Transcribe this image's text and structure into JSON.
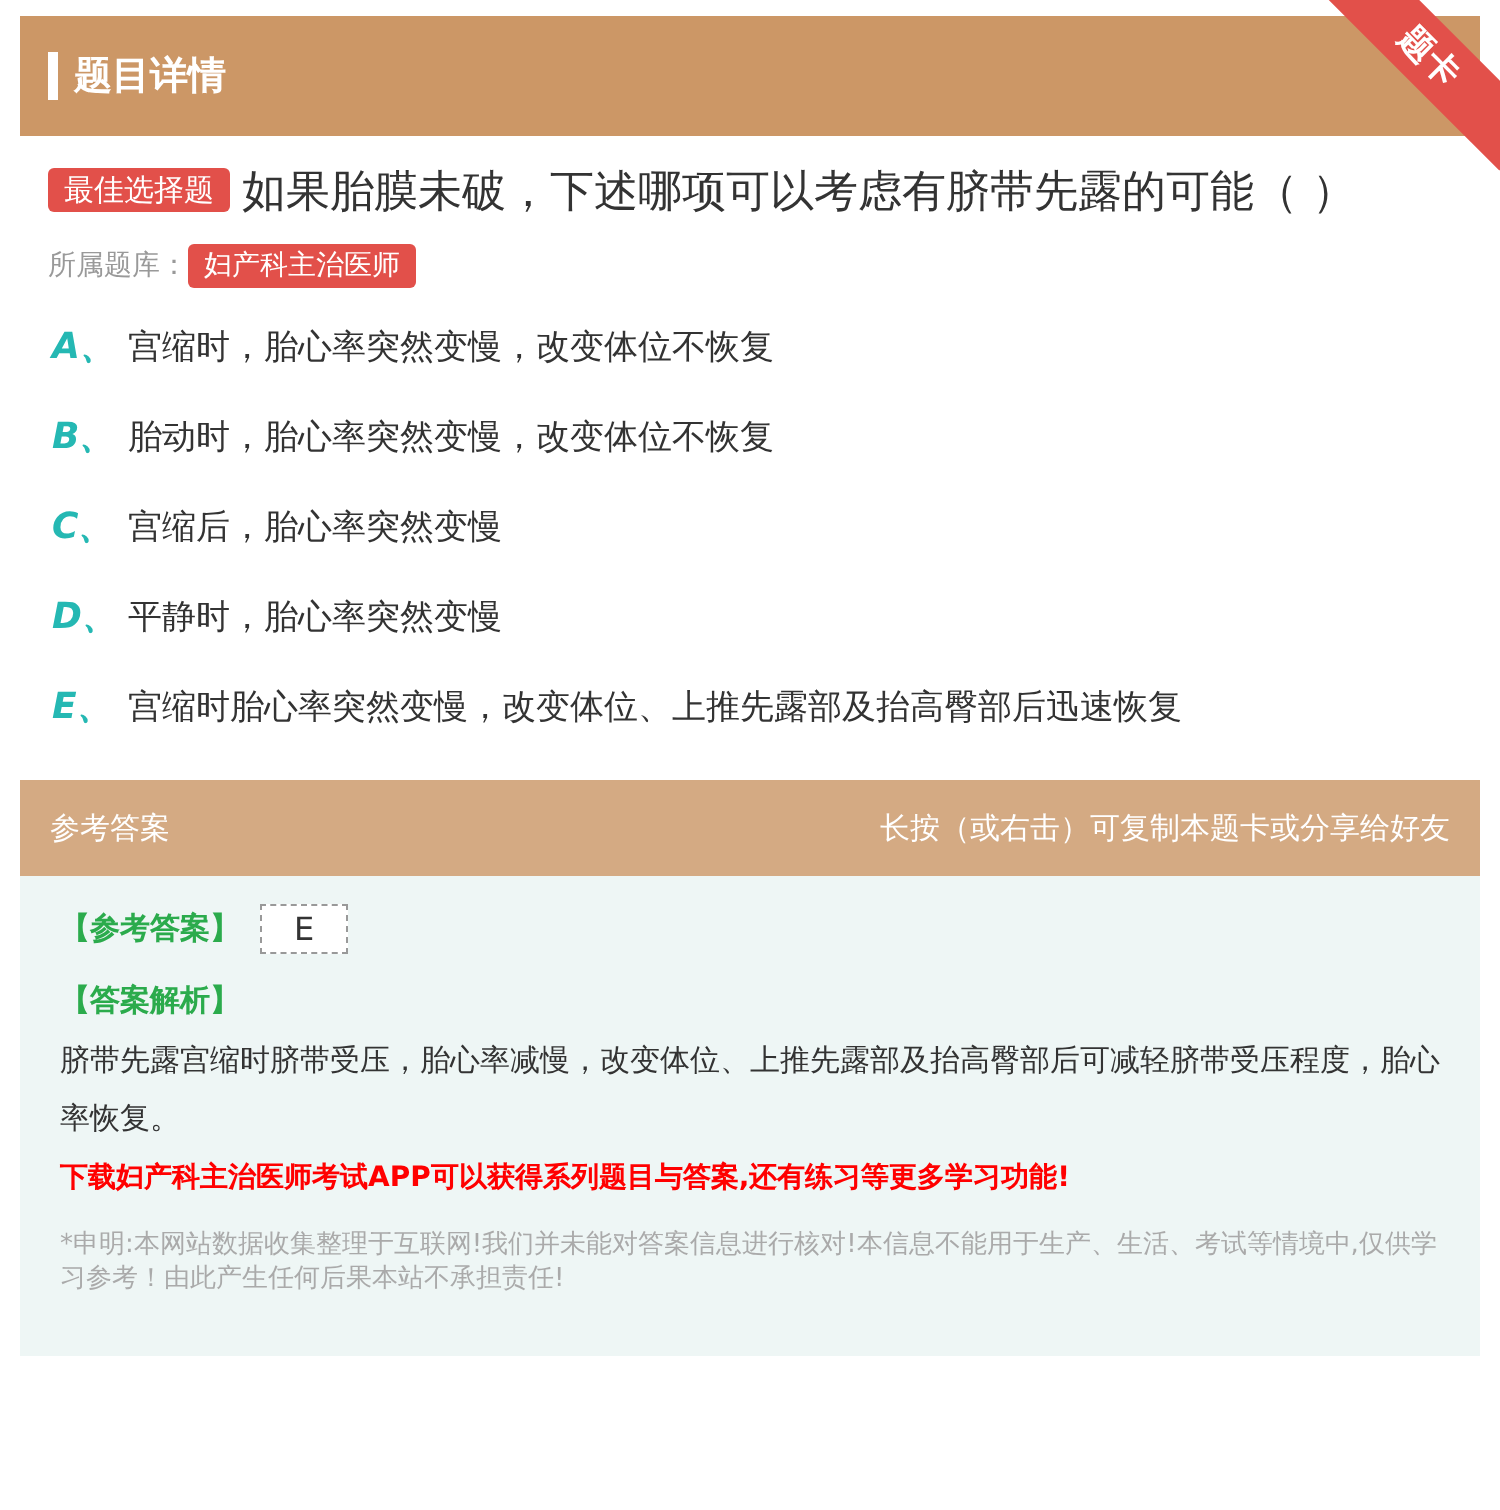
{
  "header": {
    "title": "题目详情",
    "ribbon": "题卡"
  },
  "question": {
    "type_badge": "最佳选择题",
    "text": "如果胎膜未破，下述哪项可以考虑有脐带先露的可能（ ）",
    "bank_label": "所属题库：",
    "bank": "妇产科主治医师"
  },
  "options": [
    {
      "letter": "A、",
      "text": "宫缩时，胎心率突然变慢，改变体位不恢复"
    },
    {
      "letter": "B、",
      "text": "胎动时，胎心率突然变慢，改变体位不恢复"
    },
    {
      "letter": "C、",
      "text": "宫缩后，胎心率突然变慢"
    },
    {
      "letter": "D、",
      "text": "平静时，胎心率突然变慢"
    },
    {
      "letter": "E、",
      "text": "宫缩时胎心率突然变慢，改变体位、上推先露部及抬高臀部后迅速恢复"
    }
  ],
  "answer_bar": {
    "title": "参考答案",
    "hint": "长按（或右击）可复制本题卡或分享给好友"
  },
  "answer": {
    "label": "【参考答案】",
    "value": "E",
    "analysis_label": "【答案解析】",
    "analysis": "脐带先露宫缩时脐带受压，胎心率减慢，改变体位、上推先露部及抬高臀部后可减轻脐带受压程度，胎心率恢复。",
    "promo": "下载妇产科主治医师考试APP可以获得系列题目与答案,还有练习等更多学习功能!",
    "disclaimer": "*申明:本网站数据收集整理于互联网!我们并未能对答案信息进行核对!本信息不能用于生产、生活、考试等情境中,仅供学习参考！由此产生任何后果本站不承担责任!"
  }
}
